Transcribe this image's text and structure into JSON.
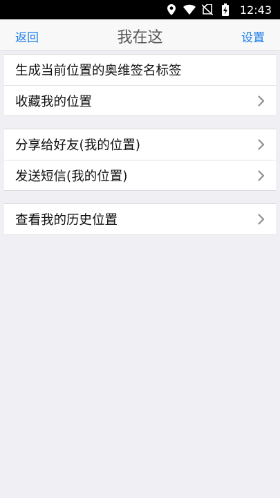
{
  "status_bar": {
    "time": "12:43",
    "icons": [
      "location-icon",
      "wifi-icon",
      "no-sim-icon",
      "battery-charging-icon"
    ]
  },
  "nav": {
    "back_label": "返回",
    "title": "我在这",
    "settings_label": "设置"
  },
  "groups": [
    {
      "items": [
        {
          "label": "生成当前位置的奥维签名标签",
          "chevron": false
        },
        {
          "label": "收藏我的位置",
          "chevron": true
        }
      ]
    },
    {
      "items": [
        {
          "label": "分享给好友(我的位置)",
          "chevron": true
        },
        {
          "label": "发送短信(我的位置)",
          "chevron": true
        }
      ]
    },
    {
      "items": [
        {
          "label": "查看我的历史位置",
          "chevron": true
        }
      ]
    }
  ],
  "colors": {
    "accent": "#1a7ee8",
    "background": "#efeff4"
  }
}
